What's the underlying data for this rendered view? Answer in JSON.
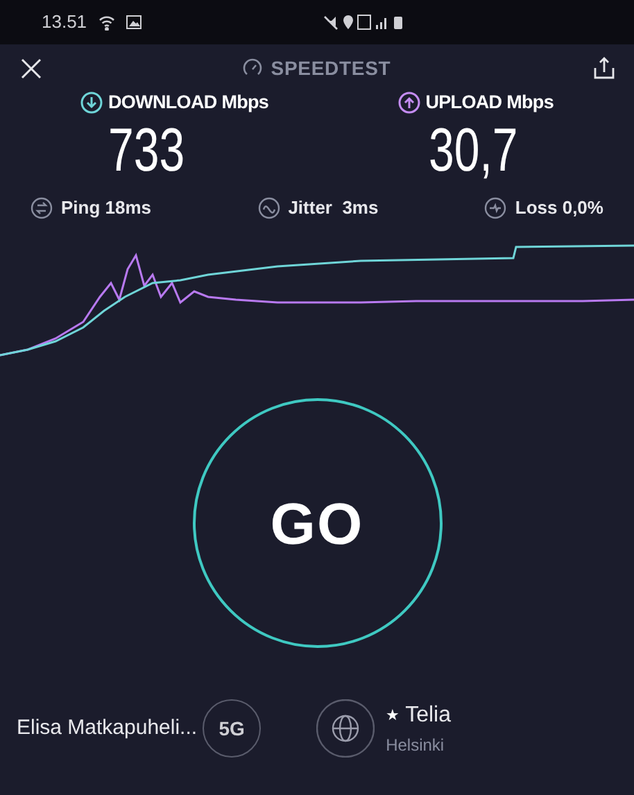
{
  "status_bar": {
    "time": "13.51"
  },
  "header": {
    "title": "SPEEDTEST"
  },
  "results": [
    {
      "kind": "download",
      "label": "DOWNLOAD Mbps",
      "value": "733"
    },
    {
      "kind": "upload",
      "label": "UPLOAD Mbps",
      "value": "30,7"
    }
  ],
  "metrics": [
    {
      "kind": "ping",
      "label": "Ping 18ms"
    },
    {
      "kind": "jitter",
      "label": "Jitter  3ms"
    },
    {
      "kind": "loss",
      "label": "Loss 0,0%"
    }
  ],
  "go_button": {
    "label": "GO"
  },
  "provider": {
    "name": "Elisa Matkapuheli...",
    "network": "5G"
  },
  "server": {
    "mark": "★",
    "name": "Telia",
    "location": "Helsinki"
  }
}
